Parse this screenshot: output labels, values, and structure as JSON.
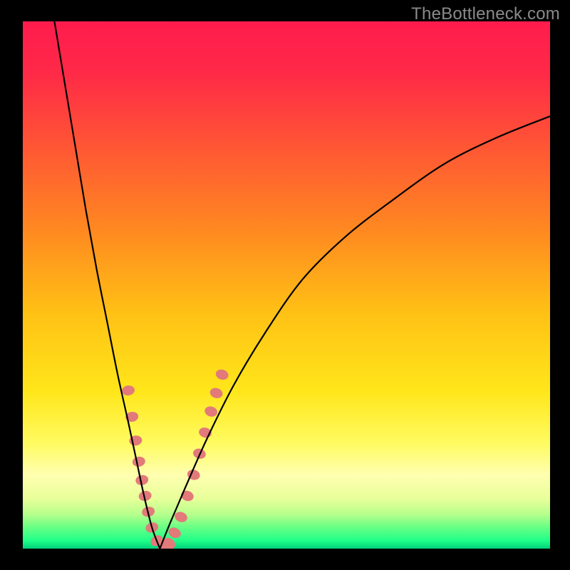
{
  "watermark": "TheBottleneck.com",
  "chart_data": {
    "type": "line",
    "title": "",
    "xlabel": "",
    "ylabel": "",
    "xlim": [
      0,
      100
    ],
    "ylim": [
      0,
      100
    ],
    "background_gradient_stops": [
      {
        "offset": 0.0,
        "color": "#ff1b4d"
      },
      {
        "offset": 0.1,
        "color": "#ff2a47"
      },
      {
        "offset": 0.25,
        "color": "#ff5a33"
      },
      {
        "offset": 0.4,
        "color": "#ff8a20"
      },
      {
        "offset": 0.55,
        "color": "#ffc015"
      },
      {
        "offset": 0.7,
        "color": "#ffe61a"
      },
      {
        "offset": 0.8,
        "color": "#fffb60"
      },
      {
        "offset": 0.86,
        "color": "#ffffb0"
      },
      {
        "offset": 0.905,
        "color": "#e8ff9a"
      },
      {
        "offset": 0.935,
        "color": "#b6ff8c"
      },
      {
        "offset": 0.96,
        "color": "#66ff84"
      },
      {
        "offset": 0.985,
        "color": "#1fff88"
      },
      {
        "offset": 1.0,
        "color": "#00d07a"
      }
    ],
    "series": [
      {
        "name": "left-branch",
        "x": [
          6,
          8,
          10,
          12,
          14,
          16,
          18,
          20,
          21.5,
          23,
          24.5,
          26
        ],
        "y": [
          100,
          88,
          76,
          64,
          53,
          43,
          33,
          24,
          17,
          10,
          4,
          0
        ]
      },
      {
        "name": "right-branch",
        "x": [
          26,
          28,
          31,
          35,
          40,
          46,
          53,
          61,
          70,
          80,
          90,
          100
        ],
        "y": [
          0,
          5,
          12,
          21,
          31,
          41,
          51,
          59,
          66,
          73,
          78,
          82
        ]
      }
    ],
    "markers_along_curve": [
      {
        "x": 20.0,
        "y": 30.0
      },
      {
        "x": 20.7,
        "y": 25.0
      },
      {
        "x": 21.4,
        "y": 20.5
      },
      {
        "x": 22.0,
        "y": 16.5
      },
      {
        "x": 22.6,
        "y": 13.0
      },
      {
        "x": 23.2,
        "y": 10.0
      },
      {
        "x": 23.8,
        "y": 7.0
      },
      {
        "x": 24.5,
        "y": 4.0
      },
      {
        "x": 25.4,
        "y": 1.5
      },
      {
        "x": 26.6,
        "y": 0.5
      },
      {
        "x": 27.8,
        "y": 1.0
      },
      {
        "x": 28.8,
        "y": 3.0
      },
      {
        "x": 30.0,
        "y": 6.0
      },
      {
        "x": 31.2,
        "y": 10.0
      },
      {
        "x": 32.4,
        "y": 14.0
      },
      {
        "x": 33.5,
        "y": 18.0
      },
      {
        "x": 34.6,
        "y": 22.0
      },
      {
        "x": 35.7,
        "y": 26.0
      },
      {
        "x": 36.7,
        "y": 29.5
      },
      {
        "x": 37.8,
        "y": 33.0
      }
    ],
    "marker_style": {
      "color": "#e27a7a",
      "rx": 7,
      "ry": 9
    },
    "curve_style": {
      "color": "#000000",
      "width": 2.2
    }
  }
}
